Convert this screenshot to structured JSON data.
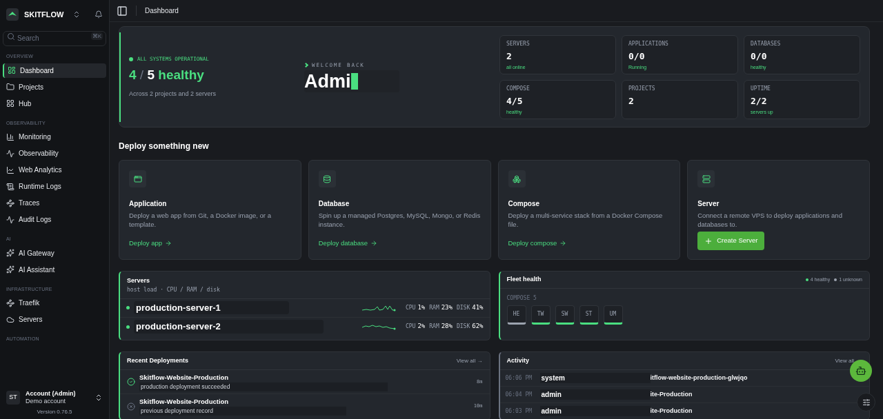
{
  "sidebar": {
    "brand": "SKITFLOW",
    "search": {
      "placeholder": "Search",
      "shortcut": "⌘K"
    },
    "sections": [
      {
        "title": "OVERVIEW",
        "items": [
          {
            "label": "Dashboard",
            "selected": true
          },
          {
            "label": "Projects",
            "selected": false
          },
          {
            "label": "Hub",
            "selected": false
          }
        ]
      },
      {
        "title": "OBSERVABILITY",
        "items": [
          {
            "label": "Monitoring",
            "selected": false
          },
          {
            "label": "Observability",
            "selected": false
          },
          {
            "label": "Web Analytics",
            "selected": false
          },
          {
            "label": "Runtime Logs",
            "selected": false
          },
          {
            "label": "Traces",
            "selected": false
          },
          {
            "label": "Audit Logs",
            "selected": false
          }
        ]
      },
      {
        "title": "AI",
        "items": [
          {
            "label": "AI Gateway",
            "selected": false
          },
          {
            "label": "AI Assistant",
            "selected": false
          }
        ]
      },
      {
        "title": "INFRASTRUCTURE",
        "items": [
          {
            "label": "Traefik",
            "selected": false
          },
          {
            "label": "Servers",
            "selected": false
          }
        ]
      },
      {
        "title": "AUTOMATION"
      }
    ],
    "account": {
      "initials": "ST",
      "name": "Account (Admin)",
      "subtitle": "Demo account"
    },
    "version": "Version 0.76.5"
  },
  "breadcrumb": "Dashboard",
  "hero": {
    "status": "ALL SYSTEMS OPERATIONAL",
    "healthy": "4",
    "separator": "/",
    "total": "5",
    "word": "healthy",
    "subtitle": "Across 2 projects and 2 servers",
    "welcome": "WELCOME BACK",
    "name": "Admi",
    "stats": [
      {
        "label": "SERVERS",
        "value": "2",
        "sub": "all online"
      },
      {
        "label": "APPLICATIONS",
        "value": "0/0",
        "sub": "Running"
      },
      {
        "label": "DATABASES",
        "value": "0/0",
        "sub": "healthy"
      },
      {
        "label": "COMPOSE",
        "value": "4/5",
        "sub": "healthy"
      },
      {
        "label": "PROJECTS",
        "value": "2"
      },
      {
        "label": "UPTIME",
        "value": "2/2",
        "sub": "servers up"
      }
    ]
  },
  "deploy": {
    "title": "Deploy something new",
    "cards": [
      {
        "kind": "link",
        "title": "Application",
        "description": "Deploy a web app from Git, a Docker image, or a template.",
        "action": "Deploy app"
      },
      {
        "kind": "link",
        "title": "Database",
        "description": "Spin up a managed Postgres, MySQL, Mongo, or Redis instance.",
        "action": "Deploy database"
      },
      {
        "kind": "link",
        "title": "Compose",
        "description": "Deploy a multi-service stack from a Docker Compose file.",
        "action": "Deploy compose"
      },
      {
        "kind": "button",
        "title": "Server",
        "description": "Connect a remote VPS to deploy applications and databases to.",
        "action": "Create Server"
      }
    ]
  },
  "servers": {
    "title": "Servers",
    "subtitle": "host load · CPU / RAM / disk",
    "rows": [
      {
        "name": "production-server-1",
        "metrics": [
          {
            "label": "CPU",
            "value": "1%"
          },
          {
            "label": "RAM",
            "value": "23%"
          },
          {
            "label": "DISK",
            "value": "41%"
          }
        ]
      },
      {
        "name": "production-server-2",
        "metrics": [
          {
            "label": "CPU",
            "value": "2%"
          },
          {
            "label": "RAM",
            "value": "28%"
          },
          {
            "label": "DISK",
            "value": "62%"
          }
        ]
      }
    ]
  },
  "fleet": {
    "title": "Fleet health",
    "legend": [
      {
        "label": "4 healthy",
        "color": "#4ade80"
      },
      {
        "label": "1 unknown",
        "color": "#9ca3af"
      }
    ],
    "group": "COMPOSE 5",
    "tiles": [
      {
        "label": "HE",
        "healthy": false
      },
      {
        "label": "TW",
        "healthy": true
      },
      {
        "label": "SW",
        "healthy": true
      },
      {
        "label": "ST",
        "healthy": true
      },
      {
        "label": "UM",
        "healthy": true
      }
    ]
  },
  "deployments": {
    "title": "Recent Deployments",
    "link": "View all →",
    "rows": [
      {
        "kind": "success",
        "name": "Skitflow-Website-Production",
        "message": "production deployment succeeded",
        "time": "8m"
      },
      {
        "kind": "cancelled",
        "name": "Skitflow-Website-Production",
        "message": "previous deployment record",
        "time": "10m"
      }
    ]
  },
  "activity": {
    "title": "Activity",
    "link": "View all",
    "rows": [
      {
        "time": "06:06 PM",
        "actor": "system",
        "target": "itflow-website-production-glwjqo"
      },
      {
        "time": "06:04 PM",
        "actor": "admin",
        "target": "ite-Production"
      },
      {
        "time": "06:03 PM",
        "actor": "admin",
        "target": "ite-Production"
      }
    ]
  }
}
